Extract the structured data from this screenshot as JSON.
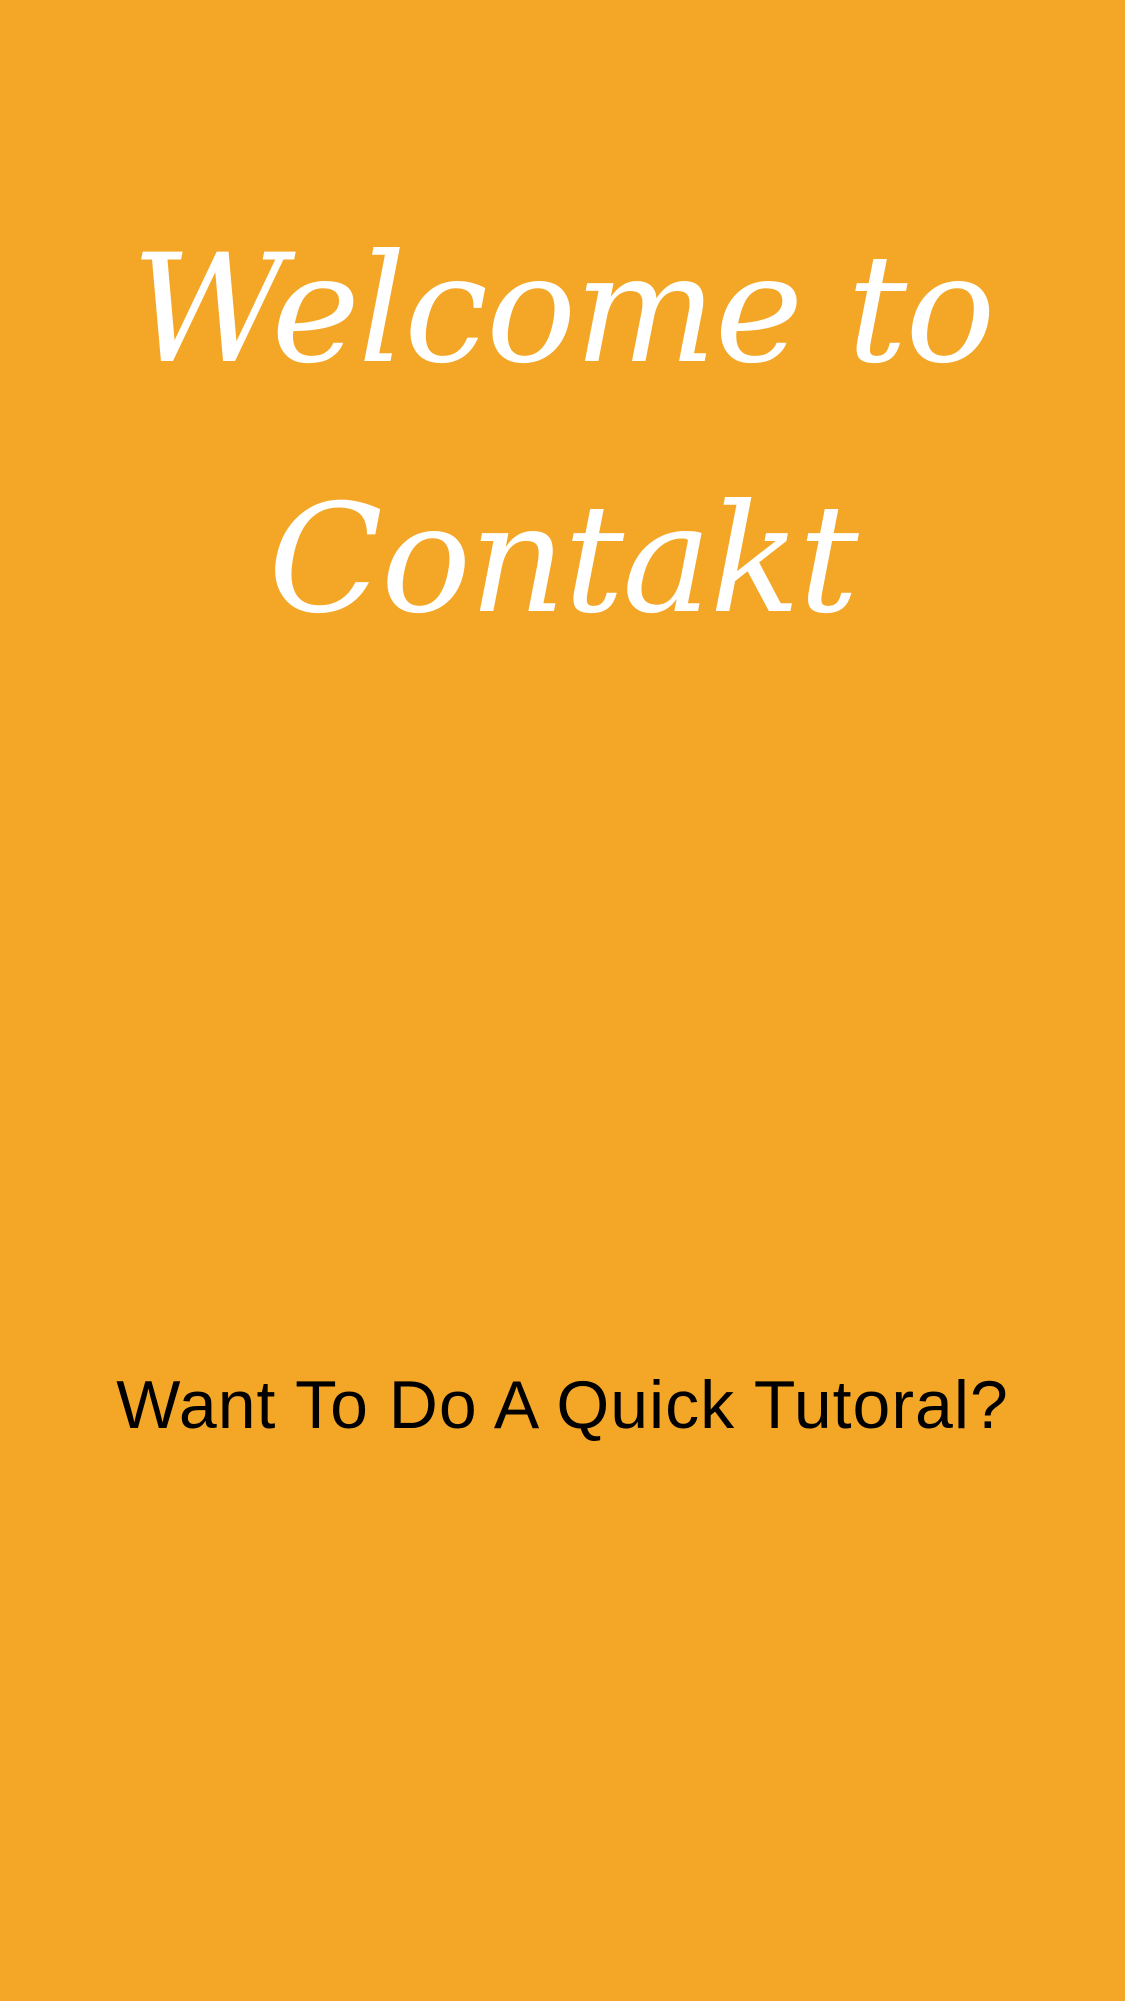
{
  "colors": {
    "background": "#F4A626",
    "title_text": "#FFFFFF",
    "prompt_text": "#000000"
  },
  "welcome": {
    "line1": "Welcome to",
    "line2": "Contakt"
  },
  "tutorial": {
    "prompt": "Want To Do A Quick Tutoral?"
  }
}
